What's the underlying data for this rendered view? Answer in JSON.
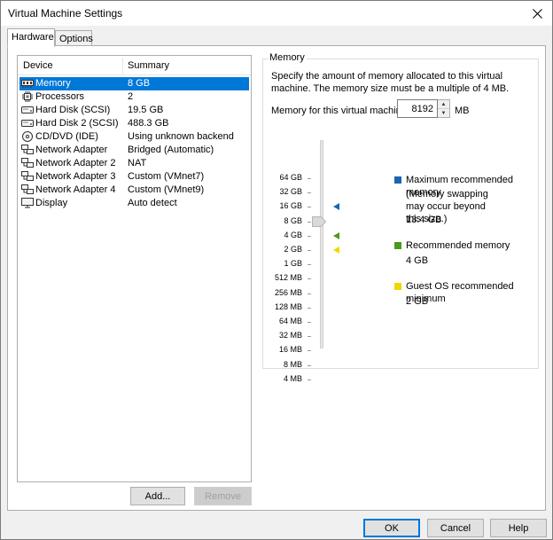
{
  "window": {
    "title": "Virtual Machine Settings"
  },
  "tabs": [
    {
      "label": "Hardware",
      "active": true
    },
    {
      "label": "Options",
      "active": false
    }
  ],
  "device_list": {
    "columns": [
      "Device",
      "Summary"
    ],
    "rows": [
      {
        "name": "Memory",
        "summary": "8 GB",
        "icon": "memory-icon",
        "selected": true
      },
      {
        "name": "Processors",
        "summary": "2",
        "icon": "processor-icon"
      },
      {
        "name": "Hard Disk (SCSI)",
        "summary": "19.5 GB",
        "icon": "hard-disk-icon"
      },
      {
        "name": "Hard Disk 2 (SCSI)",
        "summary": "488.3 GB",
        "icon": "hard-disk-icon"
      },
      {
        "name": "CD/DVD (IDE)",
        "summary": "Using unknown backend",
        "icon": "cd-dvd-icon"
      },
      {
        "name": "Network Adapter",
        "summary": "Bridged (Automatic)",
        "icon": "network-adapter-icon"
      },
      {
        "name": "Network Adapter 2",
        "summary": "NAT",
        "icon": "network-adapter-icon"
      },
      {
        "name": "Network Adapter 3",
        "summary": "Custom (VMnet7)",
        "icon": "network-adapter-icon"
      },
      {
        "name": "Network Adapter 4",
        "summary": "Custom (VMnet9)",
        "icon": "network-adapter-icon"
      },
      {
        "name": "Display",
        "summary": "Auto detect",
        "icon": "display-icon"
      }
    ]
  },
  "list_buttons": {
    "add": "Add...",
    "remove": "Remove"
  },
  "memory": {
    "group_title": "Memory",
    "description": "Specify the amount of memory allocated to this virtual machine. The memory size must be a multiple of 4 MB.",
    "field_label": "Memory for this virtual machine:",
    "value": "8192",
    "unit": "MB",
    "scale": [
      "64 GB",
      "32 GB",
      "16 GB",
      "8 GB",
      "4 GB",
      "2 GB",
      "1 GB",
      "512 MB",
      "256 MB",
      "128 MB",
      "64 MB",
      "32 MB",
      "16 MB",
      "8 MB",
      "4 MB"
    ],
    "current_level": "8 GB",
    "legend": {
      "max": {
        "title": "Maximum recommended memory",
        "note": "(Memory swapping may occur beyond this size.)",
        "value": "13.4 GB",
        "color": "#1a65b0",
        "level": "16 GB"
      },
      "recommended": {
        "title": "Recommended memory",
        "value": "4 GB",
        "color": "#4a9a1e",
        "level": "4 GB"
      },
      "guest_min": {
        "title": "Guest OS recommended minimum",
        "value": "2 GB",
        "color": "#f2d600",
        "level": "2 GB"
      }
    }
  },
  "footer": {
    "ok": "OK",
    "cancel": "Cancel",
    "help": "Help"
  },
  "colors": {
    "selection": "#0078d7",
    "accent": "#0078d7"
  }
}
